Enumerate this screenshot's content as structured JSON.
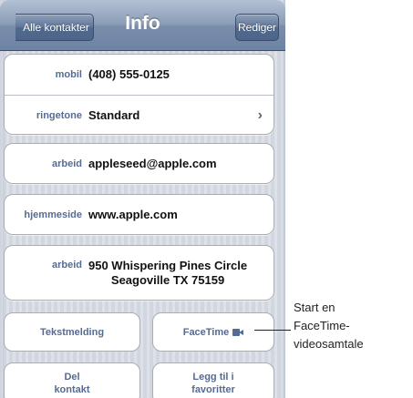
{
  "navbar": {
    "back_label": "Alle kontakter",
    "title": "Info",
    "edit_label": "Rediger"
  },
  "group1": [
    {
      "label": "mobil",
      "value": "(408) 555-0125"
    },
    {
      "label": "ringetone",
      "value": "Standard"
    }
  ],
  "email": {
    "label": "arbeid",
    "value": "appleseed@apple.com"
  },
  "homepage": {
    "label": "hjemmeside",
    "value": "www.apple.com"
  },
  "address": {
    "label": "arbeid",
    "line1": "950 Whispering Pines Circle",
    "line2": "Seagoville TX 75159"
  },
  "actions": {
    "text_message": "Tekstmelding",
    "facetime": "FaceTime",
    "share_line1": "Del",
    "share_line2": "kontakt",
    "favorite_line1": "Legg til i",
    "favorite_line2": "favoritter"
  },
  "callout": {
    "line1": "Start en",
    "line2": "FaceTime-",
    "line3": "videosamtale"
  }
}
